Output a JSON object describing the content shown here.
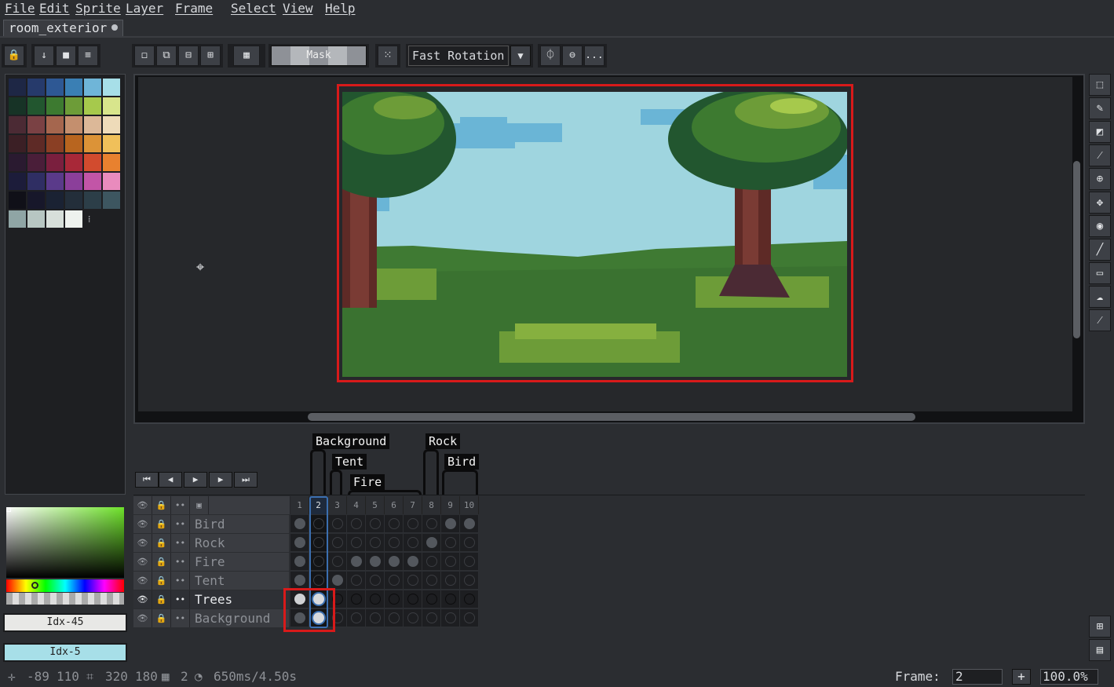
{
  "menu": [
    "File",
    "Edit",
    "Sprite",
    "Layer",
    "Frame",
    "Select",
    "View",
    "Help"
  ],
  "tab": {
    "title": "room_exterior"
  },
  "toolbar": {
    "mask_label": "Mask",
    "rotation_value": "Fast Rotation",
    "more_label": "..."
  },
  "palette": {
    "colors": [
      [
        "#1e2745",
        "#263a6b",
        "#2e5894",
        "#3a7fb4",
        "#6fb5d8",
        "#a7dfe8"
      ],
      [
        "#173326",
        "#22562f",
        "#3d7a30",
        "#6d9c38",
        "#a6c94c",
        "#d8e58c"
      ],
      [
        "#4b2a34",
        "#7a4144",
        "#a5664e",
        "#c48f6e",
        "#dcb898",
        "#eedbb9"
      ],
      [
        "#3b1f25",
        "#5e2a26",
        "#8a3f24",
        "#b8651f",
        "#dc9337",
        "#f0c05a"
      ],
      [
        "#2a1a30",
        "#4a1e39",
        "#7a1f3e",
        "#a82838",
        "#d24b2e",
        "#e8812f"
      ],
      [
        "#1c1c3a",
        "#2f2e63",
        "#5a3a8a",
        "#8b3f9a",
        "#c255a7",
        "#e98bbd"
      ],
      [
        "#101018",
        "#17172a",
        "#1a2233",
        "#232e3a",
        "#2c3e48",
        "#3d5660"
      ],
      [
        "#8fa5a5",
        "#b7c6c2",
        "#d7dfda",
        "#eef2ee"
      ]
    ]
  },
  "color_index_fg": "Idx-45",
  "color_index_bg": "Idx-5",
  "timeline": {
    "tags": [
      "Background",
      "Tent",
      "Fire",
      "Rock",
      "Bird"
    ],
    "frames": [
      "1",
      "2",
      "3",
      "4",
      "5",
      "6",
      "7",
      "8",
      "9",
      "10"
    ],
    "layers": [
      {
        "name": "Bird",
        "cels": [
          1,
          0,
          0,
          0,
          0,
          0,
          0,
          0,
          1,
          1
        ]
      },
      {
        "name": "Rock",
        "cels": [
          1,
          0,
          0,
          0,
          0,
          0,
          0,
          1,
          0,
          0
        ]
      },
      {
        "name": "Fire",
        "cels": [
          1,
          0,
          0,
          1,
          1,
          1,
          1,
          0,
          0,
          0
        ]
      },
      {
        "name": "Tent",
        "cels": [
          1,
          0,
          1,
          0,
          0,
          0,
          0,
          0,
          0,
          0
        ]
      },
      {
        "name": "Trees",
        "cels": [
          1,
          1,
          0,
          0,
          0,
          0,
          0,
          0,
          0,
          0
        ],
        "active": true
      },
      {
        "name": "Background",
        "cels": [
          1,
          1,
          0,
          0,
          0,
          0,
          0,
          0,
          0,
          0
        ]
      }
    ],
    "active_frame": 2
  },
  "status": {
    "cursor_x": "-89",
    "cursor_y": "110",
    "sprite_w": "320",
    "sprite_h": "180",
    "frame_count": "2",
    "duration": "650ms/4.50s",
    "frame_label": "Frame:",
    "frame_value": "2",
    "zoom": "100.0%"
  },
  "icons": [
    "move-cursor-icon",
    "marquee-icon",
    "pencil-icon",
    "eraser-icon",
    "spray-icon",
    "zoom-icon",
    "move-icon",
    "fill-icon",
    "line-icon",
    "rectangle-icon",
    "blur-icon",
    "eyedropper-icon"
  ]
}
